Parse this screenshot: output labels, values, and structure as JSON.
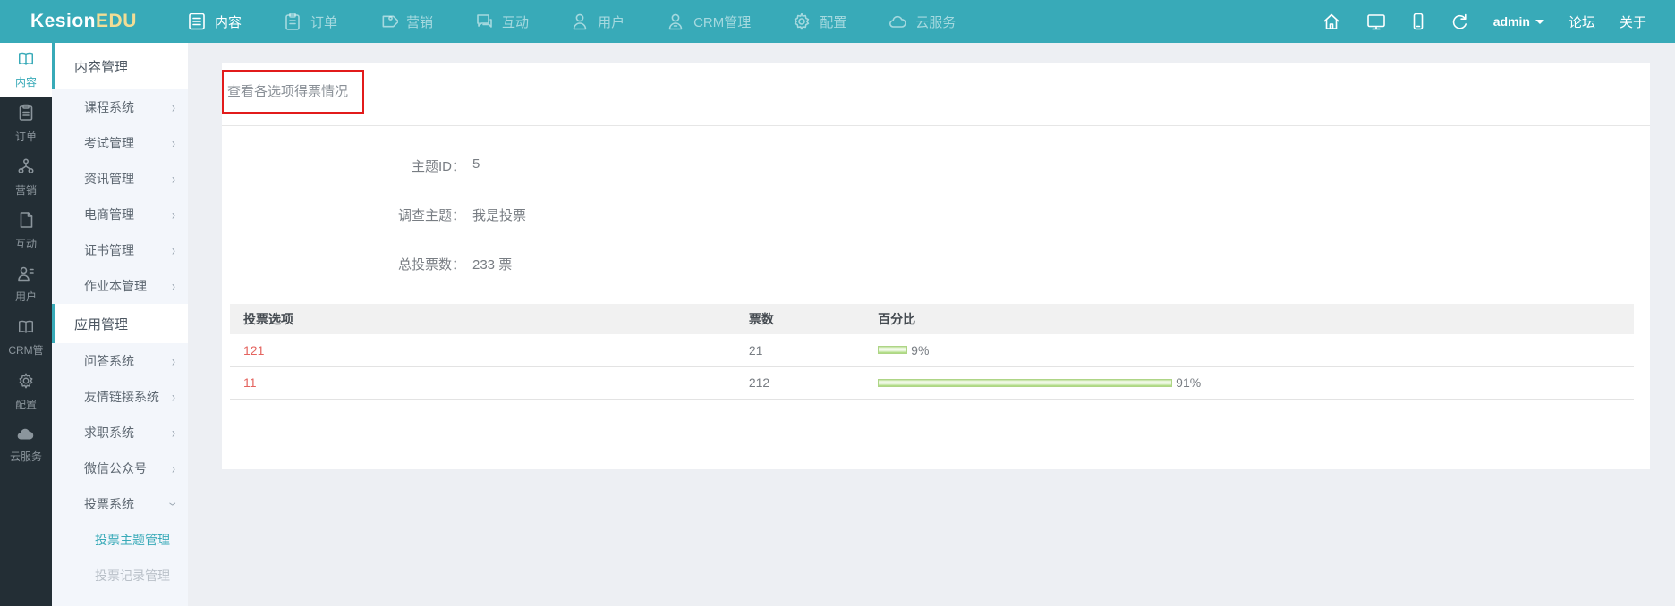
{
  "topbar": {
    "logo": {
      "brand": "Kesion",
      "suffix": "EDU"
    },
    "nav": [
      {
        "label": "内容",
        "icon": "doc-lines-icon",
        "active": true
      },
      {
        "label": "订单",
        "icon": "clipboard-icon",
        "active": false
      },
      {
        "label": "营销",
        "icon": "tag-icon",
        "active": false
      },
      {
        "label": "互动",
        "icon": "chat-icon",
        "active": false
      },
      {
        "label": "用户",
        "icon": "user-icon",
        "active": false
      },
      {
        "label": "CRM管理",
        "icon": "user-badge-icon",
        "active": false
      },
      {
        "label": "配置",
        "icon": "gear-icon",
        "active": false
      },
      {
        "label": "云服务",
        "icon": "cloud-icon",
        "active": false
      }
    ],
    "right": {
      "user": "admin",
      "forum_link": "论坛",
      "about_link": "关于"
    }
  },
  "rail": {
    "items": [
      {
        "label": "内容",
        "active": true
      },
      {
        "label": "订单",
        "active": false
      },
      {
        "label": "营销",
        "active": false
      },
      {
        "label": "互动",
        "active": false
      },
      {
        "label": "用户",
        "active": false
      },
      {
        "label": "CRM管",
        "active": false
      },
      {
        "label": "配置",
        "active": false
      },
      {
        "label": "云服务",
        "active": false
      }
    ]
  },
  "sidebar": {
    "sections": [
      {
        "title": "内容管理",
        "items": [
          {
            "label": "课程系统"
          },
          {
            "label": "考试管理"
          },
          {
            "label": "资讯管理"
          },
          {
            "label": "电商管理"
          },
          {
            "label": "证书管理"
          },
          {
            "label": "作业本管理"
          }
        ]
      },
      {
        "title": "应用管理",
        "items": [
          {
            "label": "问答系统"
          },
          {
            "label": "友情链接系统"
          },
          {
            "label": "求职系统"
          },
          {
            "label": "微信公众号"
          },
          {
            "label": "投票系统",
            "expanded": true
          }
        ],
        "subitems": [
          {
            "label": "投票主题管理",
            "active": true
          },
          {
            "label": "投票记录管理",
            "active": false
          }
        ]
      }
    ]
  },
  "main": {
    "page_title": "查看各选项得票情况",
    "fields": [
      {
        "label": "主题ID：",
        "value": "5"
      },
      {
        "label": "调查主题：",
        "value": "我是投票"
      },
      {
        "label": "总投票数：",
        "value": "233 票"
      }
    ],
    "table": {
      "columns": [
        "投票选项",
        "票数",
        "百分比"
      ],
      "rows": [
        {
          "option": "121",
          "votes": "21",
          "percent": 9,
          "percent_label": "9%"
        },
        {
          "option": "11",
          "votes": "212",
          "percent": 91,
          "percent_label": "91%"
        }
      ]
    }
  },
  "chart_data": {
    "type": "bar",
    "categories": [
      "121",
      "11"
    ],
    "values": [
      9,
      91
    ],
    "counts": [
      21,
      212
    ],
    "total_votes": 233,
    "title": "查看各选项得票情况",
    "xlabel": "投票选项",
    "ylabel": "百分比",
    "ylim": [
      0,
      100
    ]
  },
  "colors": {
    "accent_teal": "#38aab8",
    "rail_dark": "#232e35",
    "annotation_red": "#e21b1b",
    "bar_green": "#a6d774",
    "option_red": "#e4645f",
    "logo_yellow": "#f2dd95"
  }
}
